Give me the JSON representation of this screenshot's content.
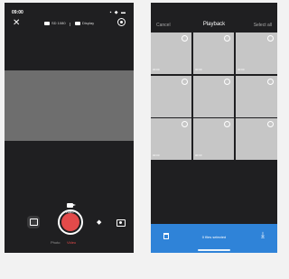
{
  "camera": {
    "status_time": "09:00",
    "status_icons": "▪ ◆ ▬",
    "mode1_label": "SD 1080",
    "mode2_label": "Display",
    "video_mode_label": "Video",
    "labels": {
      "photo": "Photo",
      "video": "Video"
    }
  },
  "playback": {
    "cancel": "Cancel",
    "title": "Playback",
    "select_all": "Select all",
    "thumbnails": [
      {
        "stamp": "00:00"
      },
      {
        "stamp": "00:00"
      },
      {
        "stamp": "00:00"
      },
      {
        "stamp": ""
      },
      {
        "stamp": ""
      },
      {
        "stamp": ""
      },
      {
        "stamp": "00:00"
      },
      {
        "stamp": "00:00"
      },
      {
        "stamp": ""
      }
    ],
    "files_selected": "0 files selected"
  },
  "colors": {
    "screen_bg": "#1f1f21",
    "preview": "#6e6e6e",
    "shutter": "#e24a4a",
    "thumbnail": "#c6c6c6",
    "action_bar": "#2f83d8"
  }
}
